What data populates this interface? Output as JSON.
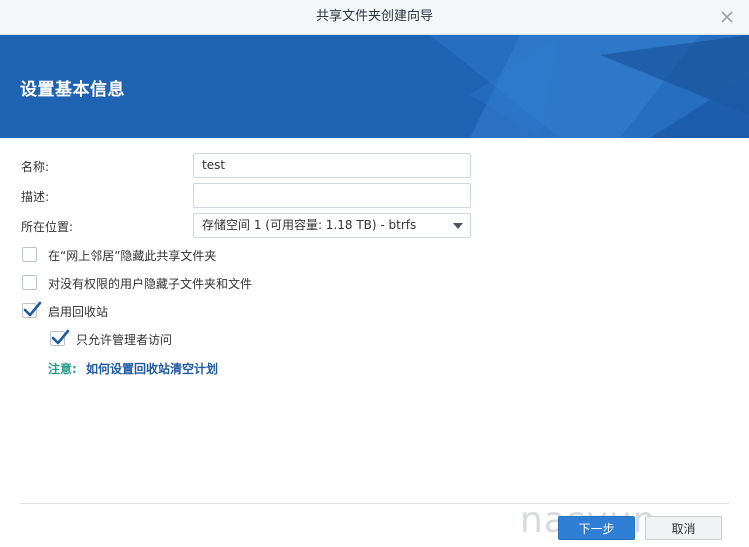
{
  "window": {
    "title": "共享文件夹创建向导"
  },
  "banner": {
    "heading": "设置基本信息"
  },
  "form": {
    "name_label": "名称:",
    "name_value": "test",
    "desc_label": "描述:",
    "desc_value": "",
    "location_label": "所在位置:",
    "location_value": "存储空间 1 (可用容量:  1.18 TB) - btrfs"
  },
  "options": {
    "hide_network": {
      "label": "在“网上邻居”隐藏此共享文件夹",
      "checked": false
    },
    "hide_subfolders": {
      "label": "对没有权限的用户隐藏子文件夹和文件",
      "checked": false
    },
    "recycle_bin": {
      "label": "启用回收站",
      "checked": true
    },
    "admin_only": {
      "label": "只允许管理者访问",
      "checked": true
    }
  },
  "note": {
    "label": "注意:",
    "link": "如何设置回收站清空计划"
  },
  "buttons": {
    "next": "下一步",
    "cancel": "取消"
  },
  "watermark": {
    "text": "nasyun"
  },
  "colors": {
    "banner": "#1f63b3",
    "primary_button": "#2f7fd6",
    "note": "#2a9d8f",
    "link": "#1f5aa6"
  }
}
